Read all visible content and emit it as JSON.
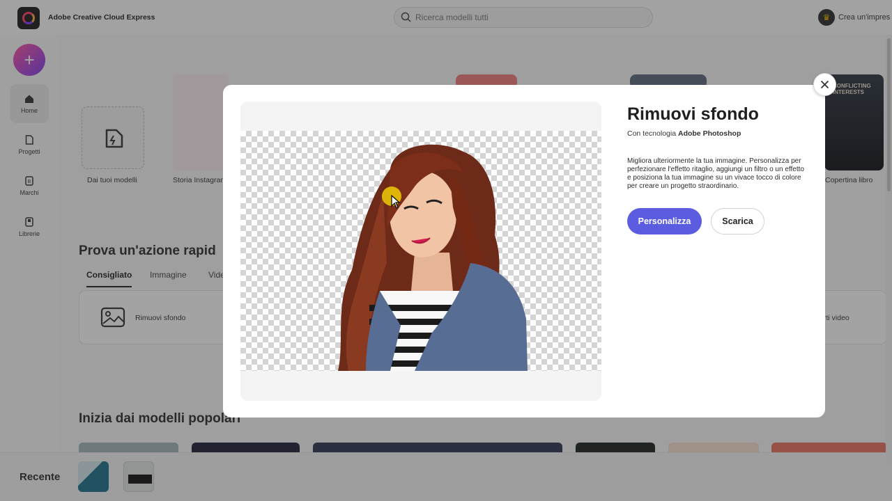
{
  "header": {
    "app_title": "Adobe Creative Cloud Express",
    "search_placeholder": "Ricerca modelli tutti",
    "premium_label": "Crea un'impres"
  },
  "sidebar": {
    "create_label": "+",
    "items": [
      {
        "label": "Home",
        "icon": "home-icon"
      },
      {
        "label": "Progetti",
        "icon": "file-icon"
      },
      {
        "label": "Marchi",
        "icon": "brand-icon"
      },
      {
        "label": "Librerie",
        "icon": "library-icon"
      }
    ]
  },
  "templates": {
    "items": [
      {
        "label": "Dai tuoi modelli"
      },
      {
        "label": "Storia Instagram"
      },
      {
        "label": "Copertina libro"
      }
    ],
    "book_cover_text": "CONFLICTING INTERESTS"
  },
  "quick_actions": {
    "heading": "Prova un'azione rapid",
    "tabs": [
      "Consigliato",
      "Immagine",
      "Vide"
    ],
    "items": [
      {
        "label": "Rimuovi sfondo"
      },
      {
        "label": "rti video"
      }
    ]
  },
  "popular": {
    "heading": "Inizia dai modelli popolari"
  },
  "recent": {
    "label": "Recente"
  },
  "modal": {
    "title": "Rimuovi sfondo",
    "subtitle_prefix": "Con tecnologia",
    "subtitle_brand": "Adobe Photoshop",
    "description": "Migliora ulteriormente la tua immagine. Personalizza per perfezionare l'effetto ritaglio, aggiungi un filtro o un effetto e posiziona la tua immagine su un vivace tocco di colore per creare un progetto straordinario.",
    "primary_button": "Personalizza",
    "secondary_button": "Scarica",
    "close_icon": "close-icon"
  },
  "colors": {
    "accent": "#5c5ce0",
    "create_gradient_start": "#ff4fa0",
    "create_gradient_end": "#7a3cf0"
  }
}
